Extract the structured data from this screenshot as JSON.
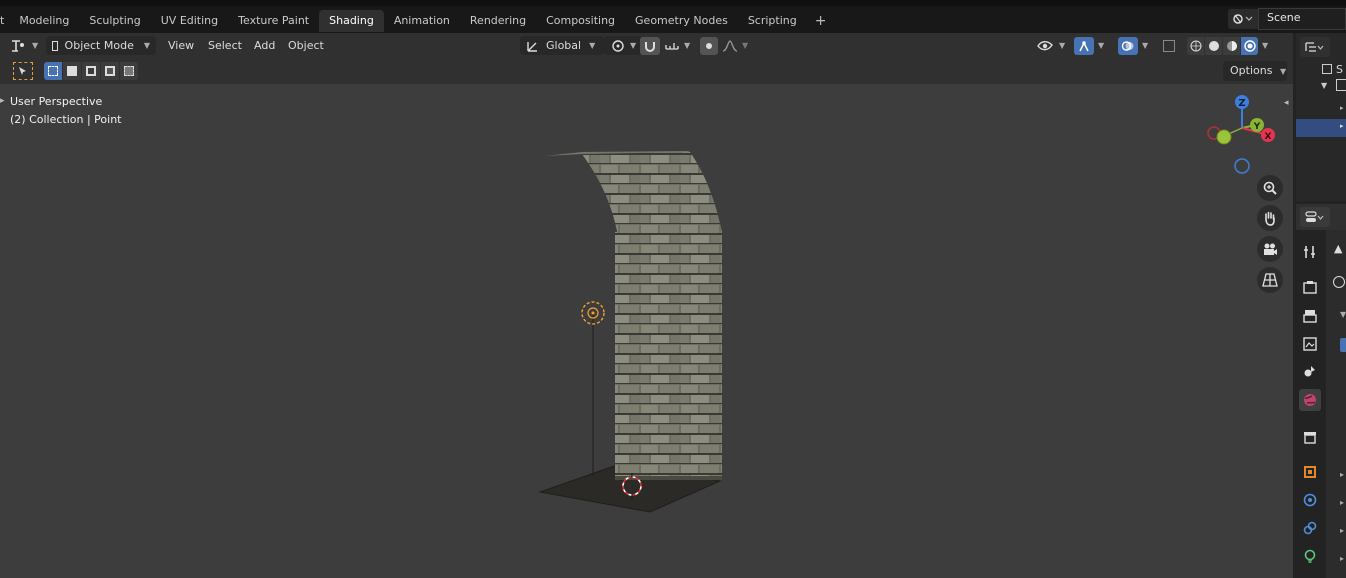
{
  "workspace_tabs": [
    {
      "label": "t",
      "active": false
    },
    {
      "label": "Modeling",
      "active": false
    },
    {
      "label": "Sculpting",
      "active": false
    },
    {
      "label": "UV Editing",
      "active": false
    },
    {
      "label": "Texture Paint",
      "active": false
    },
    {
      "label": "Shading",
      "active": true
    },
    {
      "label": "Animation",
      "active": false
    },
    {
      "label": "Rendering",
      "active": false
    },
    {
      "label": "Compositing",
      "active": false
    },
    {
      "label": "Geometry Nodes",
      "active": false
    },
    {
      "label": "Scripting",
      "active": false
    }
  ],
  "add_workspace_label": "+",
  "scene": {
    "name": "Scene"
  },
  "header": {
    "mode": "Object Mode",
    "menus": [
      "View",
      "Select",
      "Add",
      "Object"
    ],
    "transform_orientation": "Global"
  },
  "toolbar": {
    "options_label": "Options"
  },
  "viewport": {
    "perspective_label": "User Perspective",
    "context_label": "(2) Collection | Point"
  },
  "gizmo": {
    "z_label": "Z",
    "y_label": "Y",
    "x_label": "X"
  },
  "outliner": {
    "row_label": "S"
  },
  "colors": {
    "accent": "#4772b3",
    "viewport_bg": "#3d3d3d",
    "axis_x": "#e2364f",
    "axis_y": "#8ab434",
    "axis_z": "#3c7fdc",
    "light": "#f0a030"
  }
}
